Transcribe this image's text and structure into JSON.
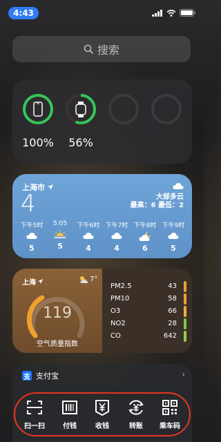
{
  "status": {
    "time": "4:43"
  },
  "search": {
    "label": "搜索"
  },
  "battery": {
    "items": [
      {
        "device": "iphone",
        "percent": "100%",
        "level": 1.0,
        "color": "#34c759"
      },
      {
        "device": "watch",
        "percent": "56%",
        "level": 0.56,
        "color": "#34c759"
      },
      {
        "device": "empty",
        "percent": "",
        "level": 0
      },
      {
        "device": "empty",
        "percent": "",
        "level": 0
      }
    ]
  },
  "weather": {
    "city": "上海市",
    "temp": "4",
    "condition": "大部多云",
    "high_low": "最高：6 最低：2",
    "hours": [
      {
        "label": "下午5时",
        "icon": "cloud-icon",
        "temp": "5"
      },
      {
        "label": "5:05",
        "icon": "sunset-icon",
        "temp": "5"
      },
      {
        "label": "下午6时",
        "icon": "cloud-icon",
        "temp": "4"
      },
      {
        "label": "下午7时",
        "icon": "cloud-icon",
        "temp": "4"
      },
      {
        "label": "下午8时",
        "icon": "cloud-moon-icon",
        "temp": "6"
      },
      {
        "label": "下午9时",
        "icon": "cloud-icon",
        "temp": "5"
      }
    ]
  },
  "aqi": {
    "city": "上海",
    "temp": "7°",
    "value": "119",
    "label": "空气质量指数",
    "pollutants": [
      {
        "name": "PM2.5",
        "value": "43",
        "color": "#f0a030"
      },
      {
        "name": "PM10",
        "value": "58",
        "color": "#f0a030"
      },
      {
        "name": "O3",
        "value": "66",
        "color": "#e8b040"
      },
      {
        "name": "NO2",
        "value": "28",
        "color": "#7cc84a"
      },
      {
        "name": "CO",
        "value": "642",
        "color": "#8fd04a"
      }
    ]
  },
  "alipay": {
    "title": "支付宝",
    "logo": "支",
    "buttons": [
      {
        "label": "扫一扫",
        "icon": "scan-icon"
      },
      {
        "label": "付钱",
        "icon": "barcode-icon"
      },
      {
        "label": "收钱",
        "icon": "yuan-receive-icon"
      },
      {
        "label": "转账",
        "icon": "transfer-icon"
      },
      {
        "label": "乘车码",
        "icon": "qr-code-icon"
      }
    ]
  }
}
